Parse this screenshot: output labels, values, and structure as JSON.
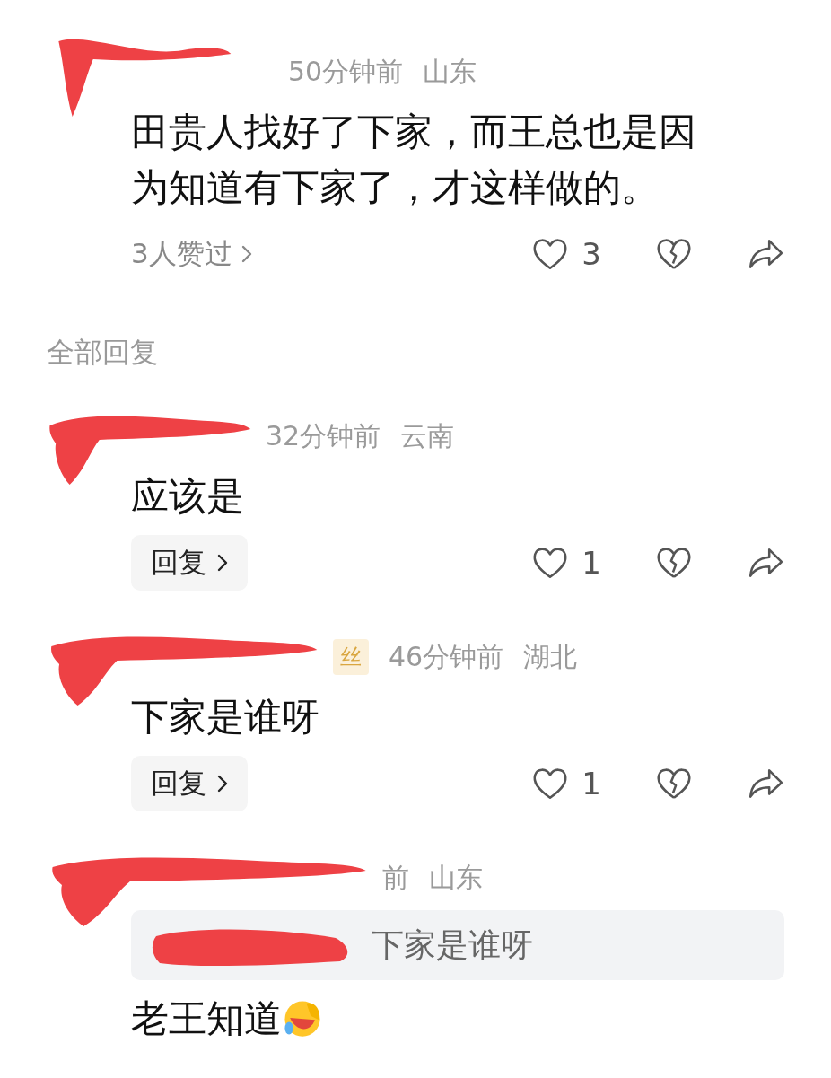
{
  "top_comment": {
    "time": "50分钟前",
    "location": "山东",
    "body": "田贵人找好了下家，而王总也是因为知道有下家了，才这样做的。",
    "likers": "3人赞过",
    "likes": "3"
  },
  "section_label": "全部回复",
  "replies": [
    {
      "time": "32分钟前",
      "location": "云南",
      "body": "应该是",
      "reply_button": "回复",
      "likes": "1"
    },
    {
      "badge": "丝",
      "time": "46分钟前",
      "location": "湖北",
      "body": "下家是谁呀",
      "reply_button": "回复",
      "likes": "1"
    },
    {
      "time": "前",
      "location": "山东",
      "quote": "下家是谁呀",
      "body": "老王知道",
      "emoji": true
    }
  ]
}
